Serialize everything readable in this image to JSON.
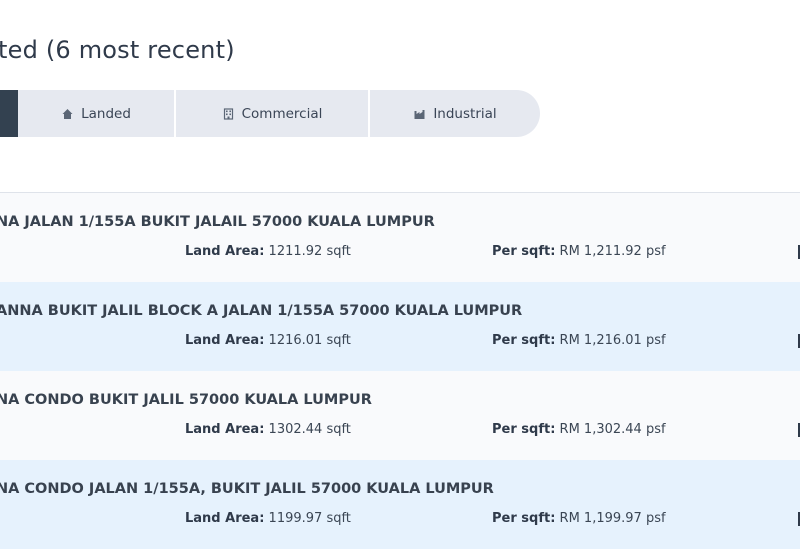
{
  "header": {
    "title": "ted (6 most recent)"
  },
  "tabs": [
    {
      "label": "Landed",
      "icon": "home-icon"
    },
    {
      "label": "Commercial",
      "icon": "building-icon"
    },
    {
      "label": "Industrial",
      "icon": "factory-icon"
    }
  ],
  "colors": {
    "active_tab": "#334150",
    "tab_bg": "#e6e9f0",
    "row_alt": "#e6f2fd"
  },
  "listings": [
    {
      "address": "NA JALAN 1/155A BUKIT JALAIL 57000 KUALA LUMPUR",
      "land_area_label": "Land Area:",
      "land_area": "1211.92 sqft",
      "per_sqft_label": "Per sqft:",
      "per_sqft": "RM 1,211.92 psf"
    },
    {
      "address": "ANNA BUKIT JALIL BLOCK A JALAN 1/155A 57000 KUALA LUMPUR",
      "land_area_label": "Land Area:",
      "land_area": "1216.01 sqft",
      "per_sqft_label": "Per sqft:",
      "per_sqft": "RM 1,216.01 psf"
    },
    {
      "address": "NA CONDO BUKIT JALIL 57000 KUALA LUMPUR",
      "land_area_label": "Land Area:",
      "land_area": "1302.44 sqft",
      "per_sqft_label": "Per sqft:",
      "per_sqft": "RM 1,302.44 psf"
    },
    {
      "address": "NA CONDO JALAN 1/155A, BUKIT JALIL 57000 KUALA LUMPUR",
      "land_area_label": "Land Area:",
      "land_area": "1199.97 sqft",
      "per_sqft_label": "Per sqft:",
      "per_sqft": "RM 1,199.97 psf"
    }
  ]
}
